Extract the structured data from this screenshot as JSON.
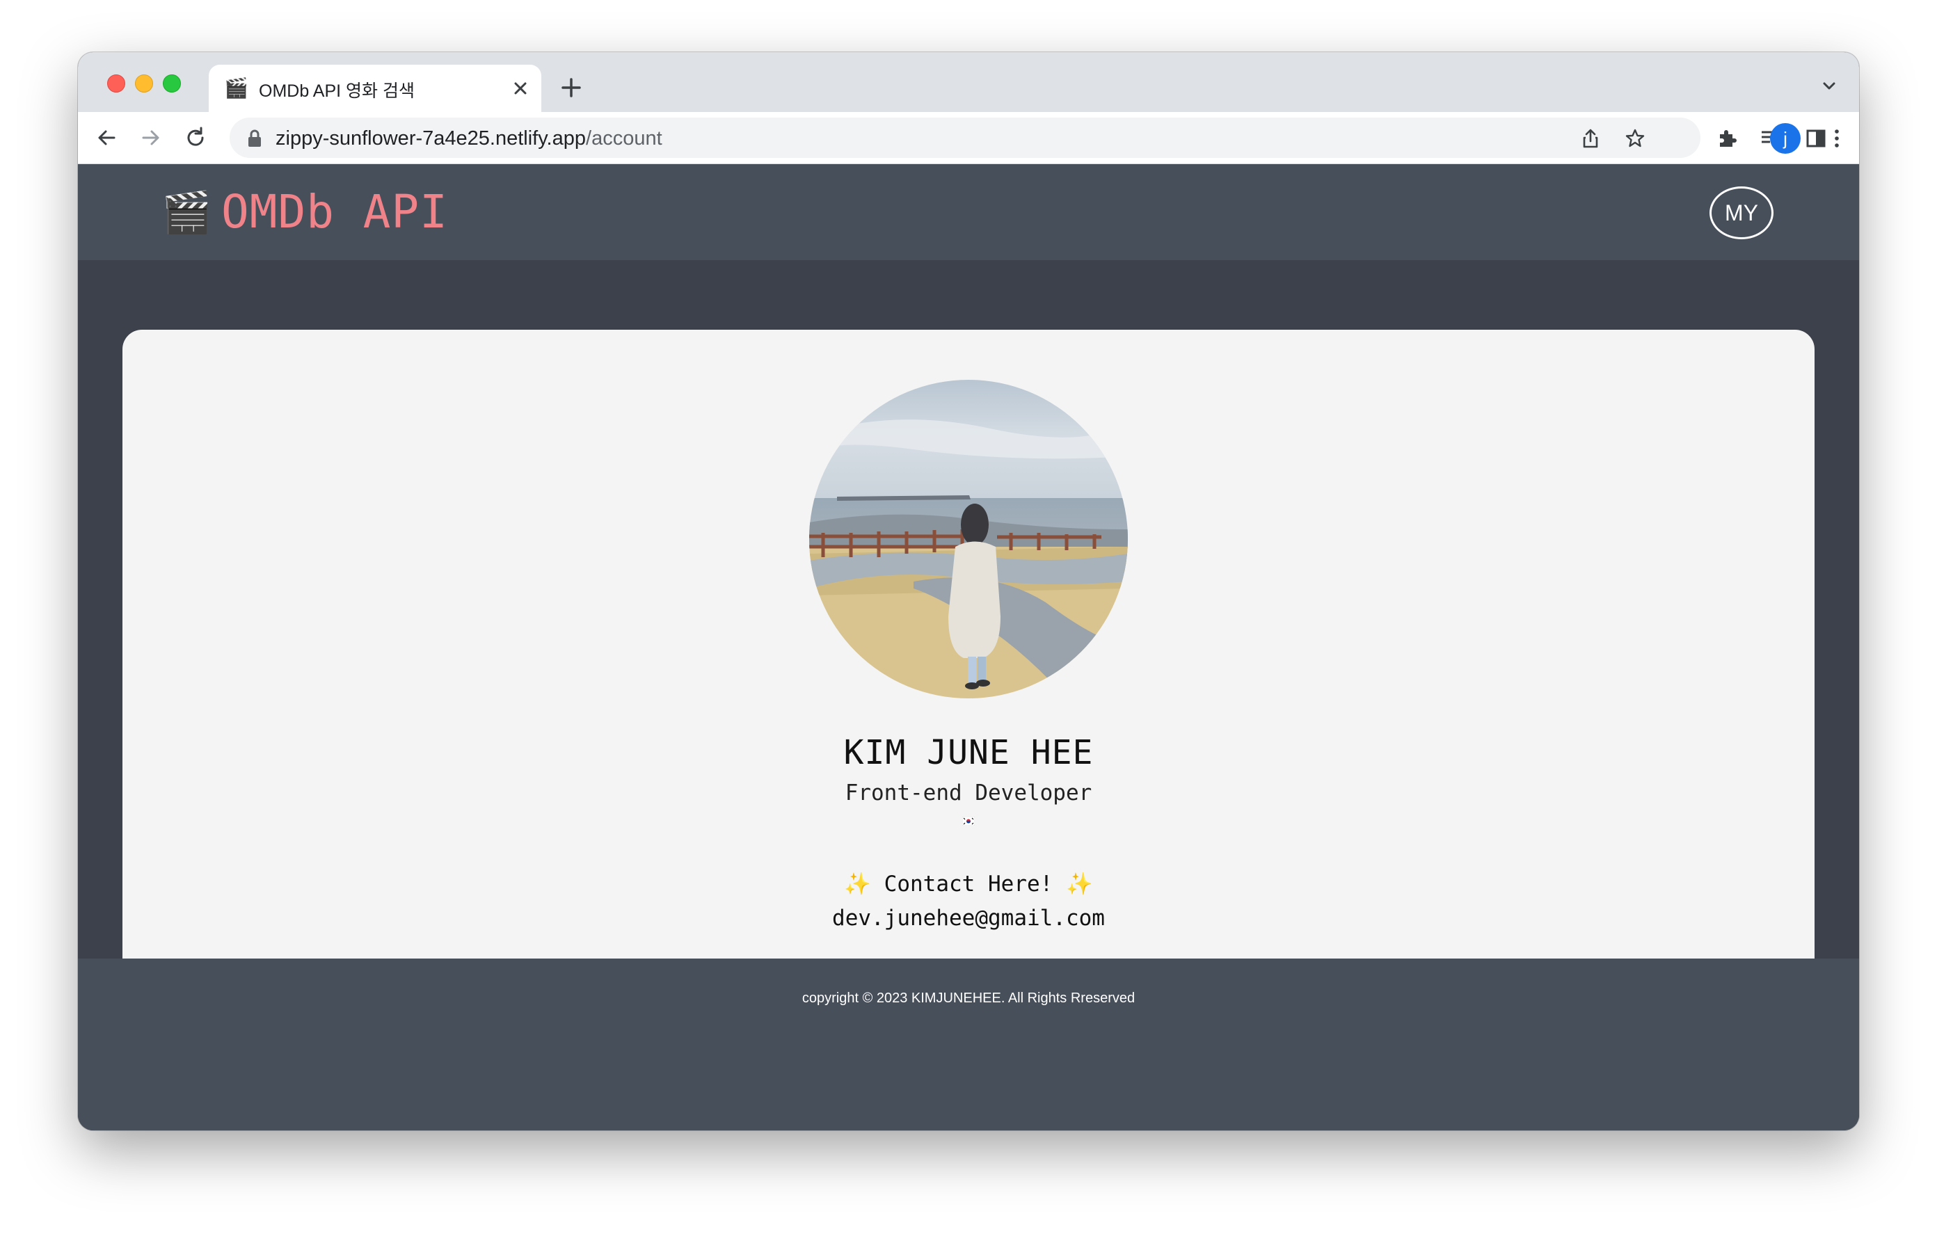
{
  "browser": {
    "tab_title": "OMDb API 영화 검색",
    "tab_favicon": "🎬",
    "url_domain": "zippy-sunflower-7a4e25.netlify.app",
    "url_path": "/account",
    "profile_initial": "j",
    "icons": [
      "back-icon",
      "forward-icon",
      "reload-icon",
      "lock-icon",
      "share-icon",
      "star-icon",
      "extensions-icon",
      "media-icon",
      "side-panel-icon",
      "more-icon",
      "tab-search-icon",
      "new-tab-icon",
      "close-icon"
    ]
  },
  "header": {
    "logo_emoji": "🎬",
    "logo_text": "OMDb API",
    "my_button": "MY"
  },
  "profile": {
    "name": "KIM JUNE HEE",
    "role": "Front-end Developer",
    "contact_label": "✨ Contact Here! ✨",
    "email": "dev.junehee@gmail.com"
  },
  "footer": {
    "copyright": "copyright © 2023 KIMJUNEHEE. All Rights Rreserved"
  }
}
